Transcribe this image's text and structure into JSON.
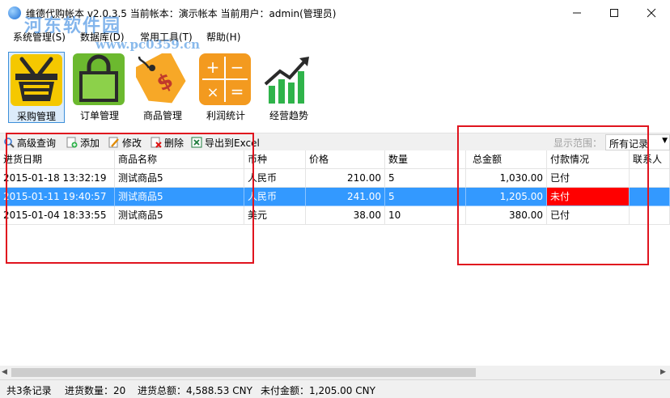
{
  "titlebar": {
    "title": "维德代购帐本  v2.0.3.5   当前帐本：演示帐本    当前用户：admin(管理员)",
    "min_symbol": "—",
    "max_symbol": "☐",
    "close_symbol": "✕"
  },
  "watermark": {
    "line1": "河东软件园",
    "line2": "www.pc0359.cn"
  },
  "menu": [
    {
      "label": "系统管理(S)"
    },
    {
      "label": "数据库(D)"
    },
    {
      "label": "常用工具(T)"
    },
    {
      "label": "帮助(H)"
    }
  ],
  "tools": [
    {
      "label": "采购管理",
      "icon": "basket-icon",
      "color": "#f2c500"
    },
    {
      "label": "订单管理",
      "icon": "shopping-bag-icon",
      "color": "#6ab82e"
    },
    {
      "label": "商品管理",
      "icon": "price-tag-icon",
      "color": "#f5a623"
    },
    {
      "label": "利润统计",
      "icon": "calculator-icon",
      "color": "#f7941d"
    },
    {
      "label": "经营趋势",
      "icon": "trend-chart-icon",
      "color": "#2fb34a"
    }
  ],
  "actions": {
    "advanced_search": "高级查询",
    "add": "添加",
    "edit": "修改",
    "delete": "删除",
    "export": "导出到Excel",
    "range_label": "显示范围：",
    "range_value": "所有记录"
  },
  "table": {
    "columns": [
      "进货日期",
      "商品名称",
      "币种",
      "价格",
      "数量",
      "总金额",
      "付款情况",
      "联系人"
    ],
    "rows": [
      {
        "date": "2015-01-18 13:32:19",
        "name": "测试商品5",
        "currency": "人民币",
        "price": "210.00",
        "qty": "5",
        "total": "1,030.00",
        "payment": "已付",
        "contact": ""
      },
      {
        "date": "2015-01-11 19:40:57",
        "name": "测试商品5",
        "currency": "人民币",
        "price": "241.00",
        "qty": "5",
        "total": "1,205.00",
        "payment": "未付",
        "contact": ""
      },
      {
        "date": "2015-01-04 18:33:55",
        "name": "测试商品5",
        "currency": "美元",
        "price": "38.00",
        "qty": "10",
        "total": "380.00",
        "payment": "已付",
        "contact": ""
      }
    ],
    "selected_row": 1
  },
  "status": {
    "records": "共3条记录",
    "qty": "进货数量：20",
    "total": "进货总额：4,588.53 CNY",
    "unpaid": "未付金额：1,205.00 CNY"
  },
  "colors": {
    "selection": "#3399ff",
    "unpaid": "#ff0000",
    "annotation": "#e0141e"
  }
}
